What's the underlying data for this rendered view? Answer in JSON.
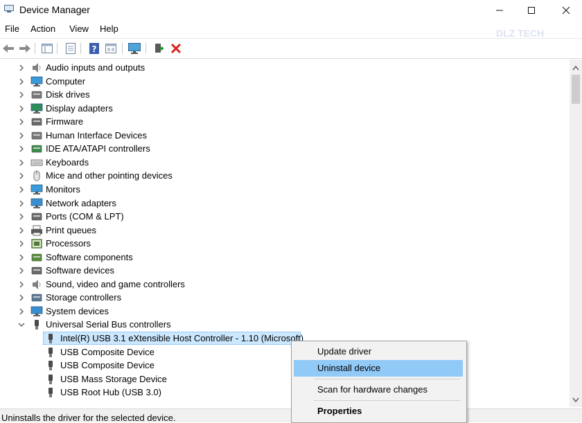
{
  "window": {
    "title": "Device Manager"
  },
  "menu": [
    "File",
    "Action",
    "View",
    "Help"
  ],
  "watermark": "DLZ TECH",
  "toolbar_icons": [
    "back-arrow-icon",
    "forward-arrow-icon",
    "console-tree-icon",
    "properties-icon",
    "help-icon",
    "view-icon",
    "monitor-scan-icon",
    "add-driver-icon",
    "uninstall-x-icon"
  ],
  "tree": {
    "categories": [
      {
        "label": "Audio inputs and outputs",
        "icon": "speaker-icon"
      },
      {
        "label": "Computer",
        "icon": "computer-icon"
      },
      {
        "label": "Disk drives",
        "icon": "disk-drive-icon"
      },
      {
        "label": "Display adapters",
        "icon": "display-adapter-icon"
      },
      {
        "label": "Firmware",
        "icon": "firmware-icon"
      },
      {
        "label": "Human Interface Devices",
        "icon": "hid-icon"
      },
      {
        "label": "IDE ATA/ATAPI controllers",
        "icon": "ide-controller-icon"
      },
      {
        "label": "Keyboards",
        "icon": "keyboard-icon"
      },
      {
        "label": "Mice and other pointing devices",
        "icon": "mouse-icon"
      },
      {
        "label": "Monitors",
        "icon": "monitor-icon"
      },
      {
        "label": "Network adapters",
        "icon": "network-adapter-icon"
      },
      {
        "label": "Ports (COM & LPT)",
        "icon": "port-icon"
      },
      {
        "label": "Print queues",
        "icon": "printer-icon"
      },
      {
        "label": "Processors",
        "icon": "processor-icon"
      },
      {
        "label": "Software components",
        "icon": "software-component-icon"
      },
      {
        "label": "Software devices",
        "icon": "software-device-icon"
      },
      {
        "label": "Sound, video and game controllers",
        "icon": "sound-controller-icon"
      },
      {
        "label": "Storage controllers",
        "icon": "storage-controller-icon"
      },
      {
        "label": "System devices",
        "icon": "system-device-icon"
      },
      {
        "label": "Universal Serial Bus controllers",
        "icon": "usb-icon",
        "expanded": true
      }
    ],
    "usb_children": [
      {
        "label": "Intel(R) USB 3.1 eXtensible Host Controller - 1.10 (Microsoft)",
        "selected": true
      },
      {
        "label": "USB Composite Device"
      },
      {
        "label": "USB Composite Device"
      },
      {
        "label": "USB Mass Storage Device"
      },
      {
        "label": "USB Root Hub (USB 3.0)"
      }
    ]
  },
  "context_menu": {
    "update": "Update driver",
    "uninstall": "Uninstall device",
    "scan": "Scan for hardware changes",
    "properties": "Properties"
  },
  "status": "Uninstalls the driver for the selected device."
}
